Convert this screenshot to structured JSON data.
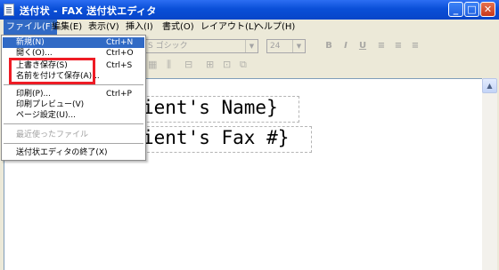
{
  "window": {
    "title": "送付状 - FAX 送付状エディタ",
    "buttons": {
      "minimize": "_",
      "maximize": "□",
      "close": "✕"
    }
  },
  "menubar": {
    "items": [
      {
        "label": "ファイル(F)",
        "active": true
      },
      {
        "label": "編集(E)"
      },
      {
        "label": "表示(V)"
      },
      {
        "label": "挿入(I)"
      },
      {
        "label": "書式(O)"
      },
      {
        "label": "レイアウト(L)"
      },
      {
        "label": "ヘルプ(H)"
      }
    ]
  },
  "toolbar": {
    "font_name": "S ゴシック",
    "font_size": "24",
    "bold": "B",
    "italic": "I",
    "underline": "U"
  },
  "file_menu": {
    "items": [
      {
        "label": "新規(N)",
        "shortcut": "Ctrl+N",
        "highlighted": true
      },
      {
        "label": "開く(O)...",
        "shortcut": "Ctrl+O"
      },
      {
        "label": "上書き保存(S)",
        "shortcut": "Ctrl+S"
      },
      {
        "label": "名前を付けて保存(A)...",
        "shortcut": ""
      },
      {
        "label": "印刷(P)...",
        "shortcut": "Ctrl+P"
      },
      {
        "label": "印刷プレビュー(V)",
        "shortcut": ""
      },
      {
        "label": "ページ設定(U)...",
        "shortcut": ""
      },
      {
        "label": "最近使ったファイル",
        "shortcut": "",
        "disabled": true
      },
      {
        "label": "送付状エディタの終了(X)",
        "shortcut": ""
      }
    ]
  },
  "document": {
    "line1": "ient's Name}",
    "line2": "ient's Fax #}"
  },
  "colors": {
    "titlebar": "#0a4fd8",
    "menu_highlight": "#316ac5",
    "annotation": "#ee1c25"
  }
}
